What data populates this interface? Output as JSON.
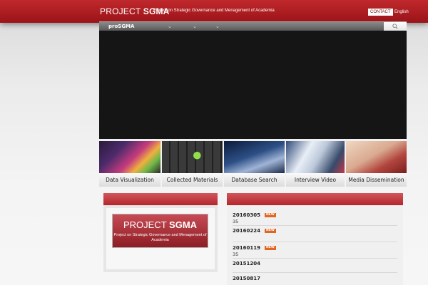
{
  "header": {
    "logo_thin": "PROJECT",
    "logo_bold": "SGMA",
    "subtitle": "Project on Strategic Governance and Menagement of Academia",
    "contact_label": "CONTACT",
    "lang_label": "English"
  },
  "nav": {
    "brand": "proSGMA",
    "dropdown_icon": "chevron-down-icon",
    "search_icon": "search-icon"
  },
  "features": [
    {
      "label": "Data Visualization"
    },
    {
      "label": "Collected Materials"
    },
    {
      "label": "Database Search"
    },
    {
      "label": "Interview Video"
    },
    {
      "label": "Media Dissemination"
    }
  ],
  "banner": {
    "title_thin": "PROJECT",
    "title_bold": "SGMA",
    "subtitle": "Project on Strategic Governance and Menagement of Academia"
  },
  "news": [
    {
      "date": "20160305",
      "badge": "NEW",
      "text": "35"
    },
    {
      "date": "20160224",
      "badge": "NEW",
      "text": ""
    },
    {
      "date": "20160119",
      "badge": "NEW",
      "text": "35"
    },
    {
      "date": "20151204",
      "badge": "",
      "text": ""
    },
    {
      "date": "20150817",
      "badge": "",
      "text": ""
    }
  ],
  "colors": {
    "brand_red": "#b3262c",
    "badge_orange": "#e06622"
  }
}
